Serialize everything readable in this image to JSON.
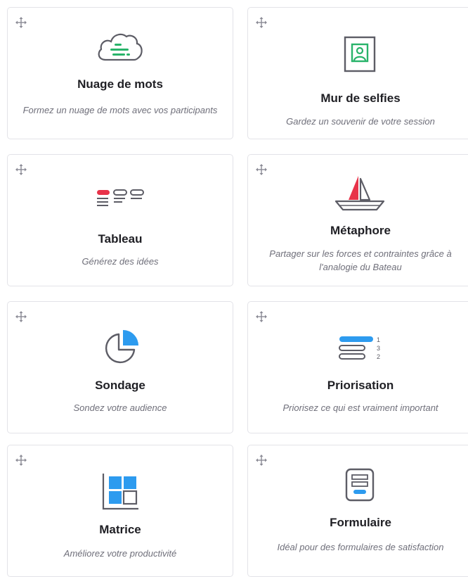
{
  "colors": {
    "green": "#28b36a",
    "red": "#e8334a",
    "blue": "#2d9bef",
    "gray": "#5d5d66"
  },
  "cards": [
    {
      "icon": "cloud-lines-icon",
      "title": "Nuage de mots",
      "description": "Formez un nuage de mots avec vos participants"
    },
    {
      "icon": "portrait-frame-icon",
      "title": "Mur de selfies",
      "description": "Gardez un souvenir de votre session"
    },
    {
      "icon": "board-columns-icon",
      "title": "Tableau",
      "description": "Générez des idées"
    },
    {
      "icon": "sailboat-icon",
      "title": "Métaphore",
      "description": "Partager sur les forces et contraintes grâce à l'analogie du Bateau"
    },
    {
      "icon": "pie-chart-icon",
      "title": "Sondage",
      "description": "Sondez votre audience"
    },
    {
      "icon": "ranked-bars-icon",
      "title": "Priorisation",
      "description": "Priorisez ce qui est vraiment important"
    },
    {
      "icon": "matrix-grid-icon",
      "title": "Matrice",
      "description": "Améliorez votre productivité"
    },
    {
      "icon": "form-icon",
      "title": "Formulaire",
      "description": "Idéal pour des formulaires de satisfaction"
    }
  ]
}
